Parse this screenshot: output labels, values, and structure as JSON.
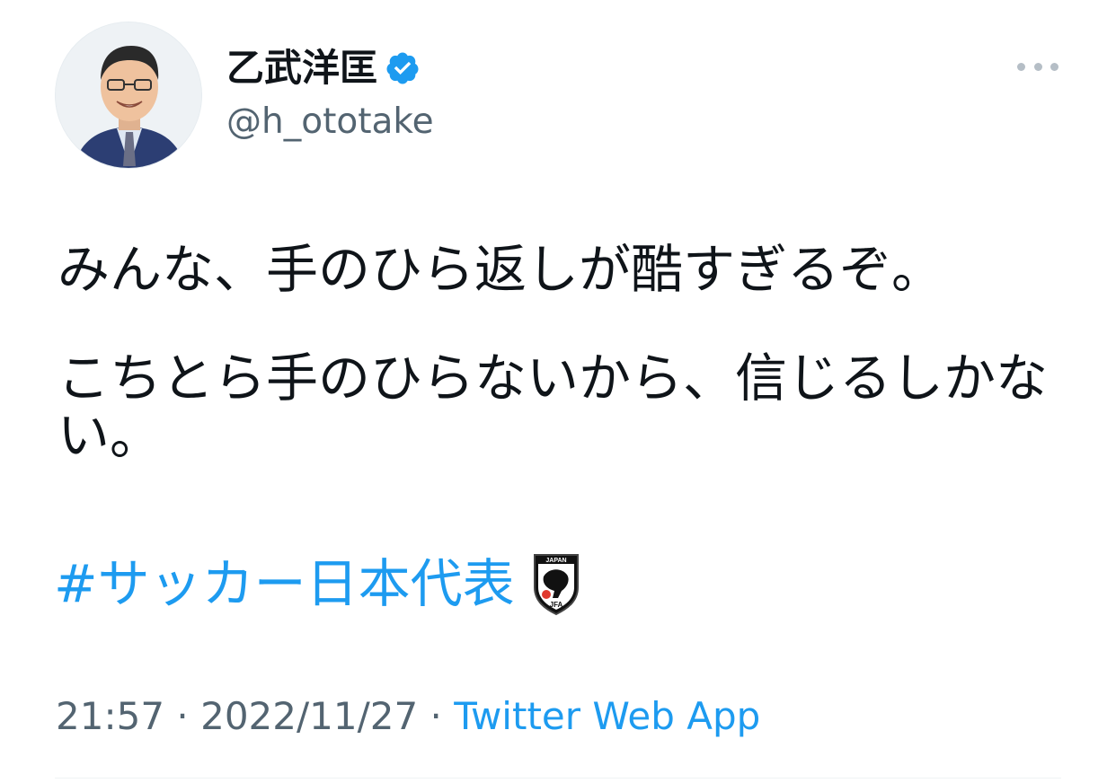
{
  "author": {
    "display_name": "乙武洋匡",
    "handle": "@h_ototake",
    "verified": true
  },
  "tweet": {
    "paragraph_1": "みんな、手のひら返しが酷すぎるぞ。",
    "paragraph_2": "こちとら手のひらないから、信じるしかない。",
    "hashtag": "#サッカー日本代表",
    "hashtag_emoji_text": "JAPAN JFA"
  },
  "meta": {
    "time": "21:57",
    "separator": " · ",
    "date": "2022/11/27",
    "source": "Twitter Web App"
  },
  "icons": {
    "verified": "verified-badge-icon",
    "more": "more-options-icon",
    "hashtag_emoji": "jfa-emblem-icon"
  },
  "colors": {
    "link": "#1d9bf0",
    "secondary_text": "#536471",
    "primary_text": "#0f1419"
  }
}
